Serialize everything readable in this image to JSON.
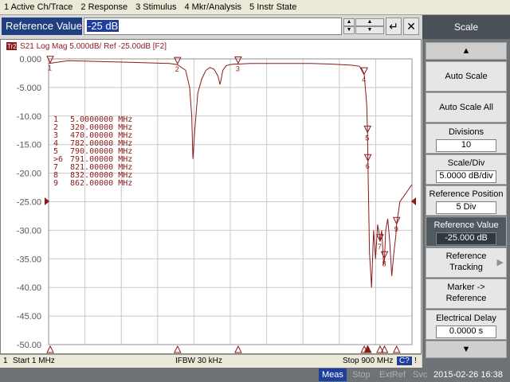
{
  "menubar": {
    "items": [
      "1 Active Ch/Trace",
      "2 Response",
      "3 Stimulus",
      "4 Mkr/Analysis",
      "5 Instr State"
    ]
  },
  "entry": {
    "label": "Reference Value",
    "value": "-25 dB",
    "enter_icon": "enter-icon",
    "close_icon": "close-icon"
  },
  "chart": {
    "trace_label": "Tr2",
    "header": "S21 Log Mag 5.000dB/ Ref -25.00dB [F2]",
    "y_ticks": [
      "0.000",
      "-5.000",
      "-10.00",
      "-15.00",
      "-20.00",
      "-25.00",
      "-30.00",
      "-35.00",
      "-40.00",
      "-45.00",
      "-50.00"
    ],
    "markers": [
      {
        "num": "1",
        "freq": "5.0000000 MHz"
      },
      {
        "num": "2",
        "freq": "320.00000 MHz"
      },
      {
        "num": "3",
        "freq": "470.00000 MHz"
      },
      {
        "num": "4",
        "freq": "782.00000 MHz"
      },
      {
        "num": "5",
        "freq": "790.00000 MHz"
      },
      {
        "num": ">6",
        "freq": "791.00000 MHz"
      },
      {
        "num": "7",
        "freq": "821.00000 MHz"
      },
      {
        "num": "8",
        "freq": "832.00000 MHz"
      },
      {
        "num": "9",
        "freq": "862.00000 MHz"
      }
    ],
    "trace_color": "#8b1a1a",
    "ref_marker_color": "#8b1a1a"
  },
  "chart_data": {
    "type": "line",
    "title": "S21 Log Mag 5.000dB/ Ref -25.00dB [F2]",
    "xlabel": "",
    "ylabel": "",
    "xlim": [
      1,
      900
    ],
    "ylim": [
      -50,
      0
    ],
    "grid": true,
    "series": [
      {
        "name": "S21",
        "x": [
          1,
          50,
          100,
          150,
          200,
          250,
          300,
          320,
          340,
          350,
          355,
          358,
          362,
          370,
          380,
          390,
          400,
          410,
          420,
          425,
          428,
          432,
          440,
          450,
          460,
          470,
          500,
          550,
          600,
          650,
          700,
          750,
          770,
          782,
          788,
          790,
          791,
          795,
          800,
          805,
          810,
          815,
          820,
          821,
          825,
          830,
          832,
          835,
          840,
          845,
          850,
          855,
          860,
          862,
          870,
          880,
          890,
          900
        ],
        "y": [
          -0.8,
          -0.3,
          -0.4,
          -0.5,
          -0.6,
          -0.7,
          -0.8,
          -1.0,
          -2.0,
          -5.0,
          -10.0,
          -17.5,
          -13.0,
          -6.0,
          -3.5,
          -2.0,
          -1.5,
          -1.8,
          -3.0,
          -4.5,
          -3.5,
          -2.0,
          -1.2,
          -1.0,
          -0.9,
          -0.9,
          -0.8,
          -0.8,
          -0.8,
          -0.8,
          -0.9,
          -1.1,
          -1.3,
          -2.8,
          -8.0,
          -13.0,
          -18.0,
          -34.0,
          -40.0,
          -30.0,
          -35.0,
          -29.0,
          -31.0,
          -32.0,
          -30.0,
          -36.0,
          -35.0,
          -30.0,
          -28.0,
          -32.0,
          -38.0,
          -34.0,
          -31.0,
          -29.0,
          -25.0,
          -24.0,
          -23.0,
          -22.0
        ]
      }
    ],
    "markers": [
      {
        "num": "1",
        "x": 5,
        "y": -0.8
      },
      {
        "num": "2",
        "x": 320,
        "y": -1.0
      },
      {
        "num": "3",
        "x": 470,
        "y": -0.9
      },
      {
        "num": "4",
        "x": 782,
        "y": -2.8
      },
      {
        "num": "5",
        "x": 790,
        "y": -13.0
      },
      {
        "num": "6",
        "x": 791,
        "y": -18.0
      },
      {
        "num": "7",
        "x": 821,
        "y": -32.0
      },
      {
        "num": "8",
        "x": 832,
        "y": -35.0
      },
      {
        "num": "9",
        "x": 862,
        "y": -29.0
      }
    ],
    "reference_value": -25.0
  },
  "status1": {
    "channel": "1",
    "start": "Start 1 MHz",
    "ifbw": "IFBW 30 kHz",
    "stop": "Stop 900 MHz",
    "c2": "C?",
    "bang": "!"
  },
  "status2": {
    "meas": "Meas",
    "stop": "Stop",
    "extref": "ExtRef",
    "svc": "Svc",
    "datetime": "2015-02-26 16:38"
  },
  "softkeys": {
    "title": "Scale",
    "auto_scale": "Auto Scale",
    "auto_scale_all": "Auto Scale All",
    "divisions_label": "Divisions",
    "divisions_value": "10",
    "scale_div_label": "Scale/Div",
    "scale_div_value": "5.0000 dB/div",
    "ref_pos_label": "Reference Position",
    "ref_pos_value": "5 Div",
    "ref_val_label": "Reference Value",
    "ref_val_value": "-25.000 dB",
    "ref_tracking_1": "Reference",
    "ref_tracking_2": "Tracking",
    "marker_ref_1": "Marker ->",
    "marker_ref_2": "Reference",
    "elec_delay_label": "Electrical Delay",
    "elec_delay_value": "0.0000 s"
  }
}
